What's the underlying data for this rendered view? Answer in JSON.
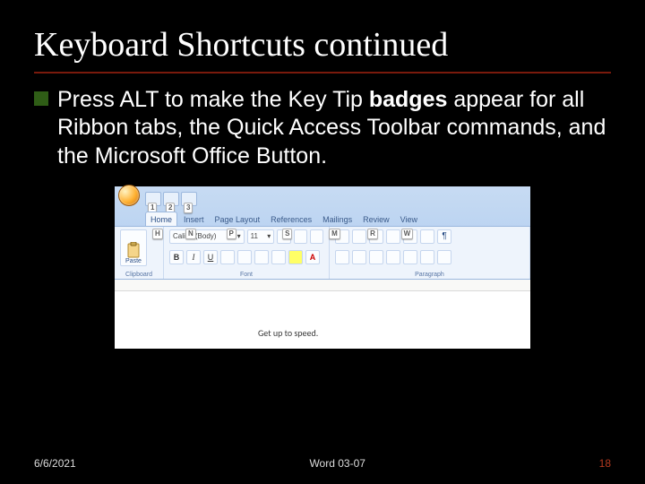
{
  "slide": {
    "title": "Keyboard Shortcuts continued",
    "bullet_pre": "Press ALT to make the Key Tip ",
    "bullet_bold": "badges",
    "bullet_post": " appear for all Ribbon tabs, the Quick Access Toolbar commands, and the Microsoft Office Button."
  },
  "ribbon": {
    "qat_badges": [
      "1",
      "2",
      "3"
    ],
    "tabs": [
      {
        "label": "Home",
        "key": "H",
        "active": true
      },
      {
        "label": "Insert",
        "key": "N"
      },
      {
        "label": "Page Layout",
        "key": "P"
      },
      {
        "label": "References",
        "key": "S"
      },
      {
        "label": "Mailings",
        "key": "M"
      },
      {
        "label": "Review",
        "key": "R"
      },
      {
        "label": "View",
        "key": "W"
      }
    ],
    "font_name": "Calibri (Body)",
    "font_size": "11",
    "groups": {
      "clipboard": "Clipboard",
      "font": "Font",
      "paragraph": "Paragraph"
    },
    "paste": "Paste"
  },
  "document": {
    "visible_text": "Get up to speed."
  },
  "footer": {
    "date": "6/6/2021",
    "center": "Word 03-07",
    "page": "18"
  }
}
